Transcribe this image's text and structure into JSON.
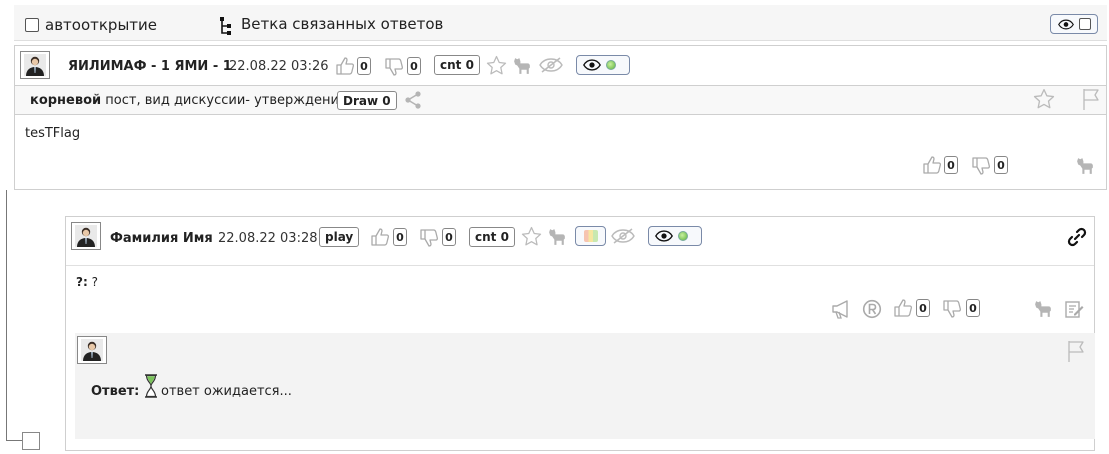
{
  "topbar": {
    "autoopen_label": "автооткрытие",
    "tree_label": "Ветка связанных ответов"
  },
  "root_post": {
    "author": "ЯИЛИМАФ - 1 ЯМИ - 1",
    "date": "22.08.22 03:26",
    "likes": "0",
    "dislikes": "0",
    "cnt": "cnt 0",
    "root_label": "корневой",
    "root_desc": " пост, вид дискуссии- утверждение",
    "draw": "Draw 0",
    "body": "tesTFlag",
    "footer_likes": "0",
    "footer_dislikes": "0"
  },
  "reply_post": {
    "author": "Фамилия Имя",
    "date": "22.08.22 03:28",
    "play": "play",
    "likes": "0",
    "dislikes": "0",
    "cnt": "cnt 0",
    "question_label": "?:",
    "question_text": " ?",
    "footer_likes": "0",
    "footer_dislikes": "0",
    "answer_label": "Ответ:",
    "answer_text": "ответ ожидается..."
  },
  "colors": {
    "icon_gray": "#b5b5b5",
    "accent_green": "#5fb43a",
    "badge_border": "#7a8aa8"
  }
}
